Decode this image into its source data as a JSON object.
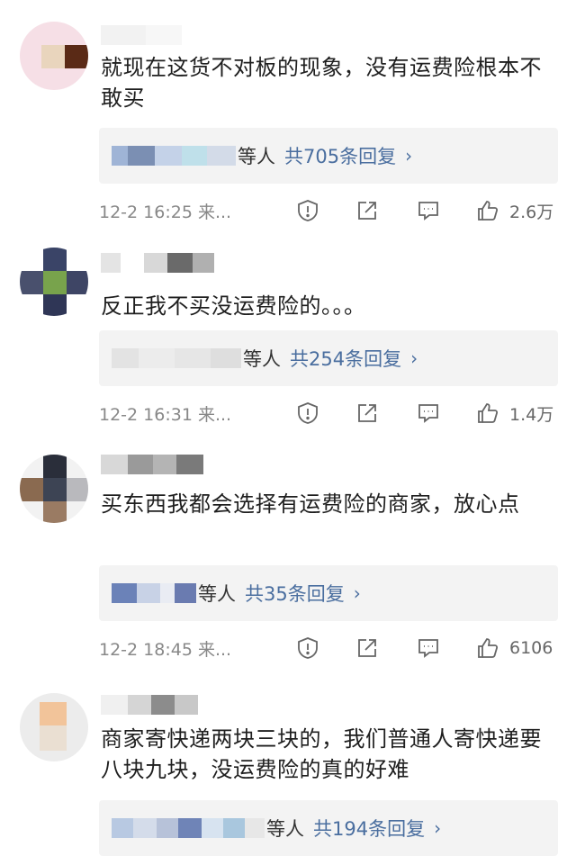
{
  "comments": [
    {
      "text": "就现在这货不对板的现象，没有运费险根本不敢买",
      "reply_suffix": "等人",
      "reply_count": "共705条回复",
      "chevron": "›",
      "time": "12-2 16:25 来...",
      "likes": "2.6万"
    },
    {
      "text": "反正我不买没运费险的。。。",
      "reply_suffix": "等人",
      "reply_count": "共254条回复",
      "chevron": "›",
      "time": "12-2 16:31 来...",
      "likes": "1.4万"
    },
    {
      "text": "买东西我都会选择有运费险的商家，放心点",
      "reply_suffix": "等人",
      "reply_count": "共35条回复",
      "chevron": "›",
      "time": "12-2 18:45 来...",
      "likes": "6106"
    },
    {
      "text": "商家寄快递两块三块的，我们普通人寄快递要八块九块，没运费险的真的好难",
      "reply_suffix": "等人",
      "reply_count": "共194条回复",
      "chevron": "›"
    }
  ],
  "icons": [
    "report-icon",
    "share-icon",
    "comment-icon",
    "like-icon"
  ],
  "colors": {
    "link": "#4a6e9f",
    "reply_bg": "#f3f3f3",
    "meta": "#888888"
  }
}
